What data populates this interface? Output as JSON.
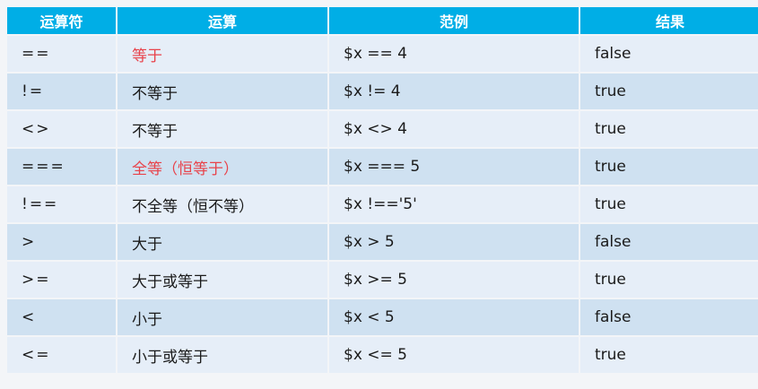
{
  "colors": {
    "header_bg": "#00aee6",
    "row_light": "#e6eef8",
    "row_dark": "#cfe1f1",
    "highlight_text": "#e8424a"
  },
  "table": {
    "headers": [
      "运算符",
      "运算",
      "范例",
      "结果"
    ],
    "rows": [
      {
        "operator": "==",
        "operation": "等于",
        "example": "$x == 4",
        "result": "false",
        "highlight": true
      },
      {
        "operator": "!=",
        "operation": "不等于",
        "example": "$x != 4",
        "result": "true",
        "highlight": false
      },
      {
        "operator": "<>",
        "operation": "不等于",
        "example": "$x <> 4",
        "result": "true",
        "highlight": false
      },
      {
        "operator": "===",
        "operation": "全等（恒等于）",
        "example": "$x === 5",
        "result": "true",
        "highlight": true
      },
      {
        "operator": "!==",
        "operation": "不全等（恒不等）",
        "example": "$x !=='5'",
        "result": "true",
        "highlight": false
      },
      {
        "operator": ">",
        "operation": "大于",
        "example": "$x > 5",
        "result": "false",
        "highlight": false
      },
      {
        "operator": ">=",
        "operation": "大于或等于",
        "example": "$x >= 5",
        "result": "true",
        "highlight": false
      },
      {
        "operator": "<",
        "operation": "小于",
        "example": "$x < 5",
        "result": "false",
        "highlight": false
      },
      {
        "operator": "<=",
        "operation": "小于或等于",
        "example": "$x <= 5",
        "result": "true",
        "highlight": false
      }
    ]
  }
}
